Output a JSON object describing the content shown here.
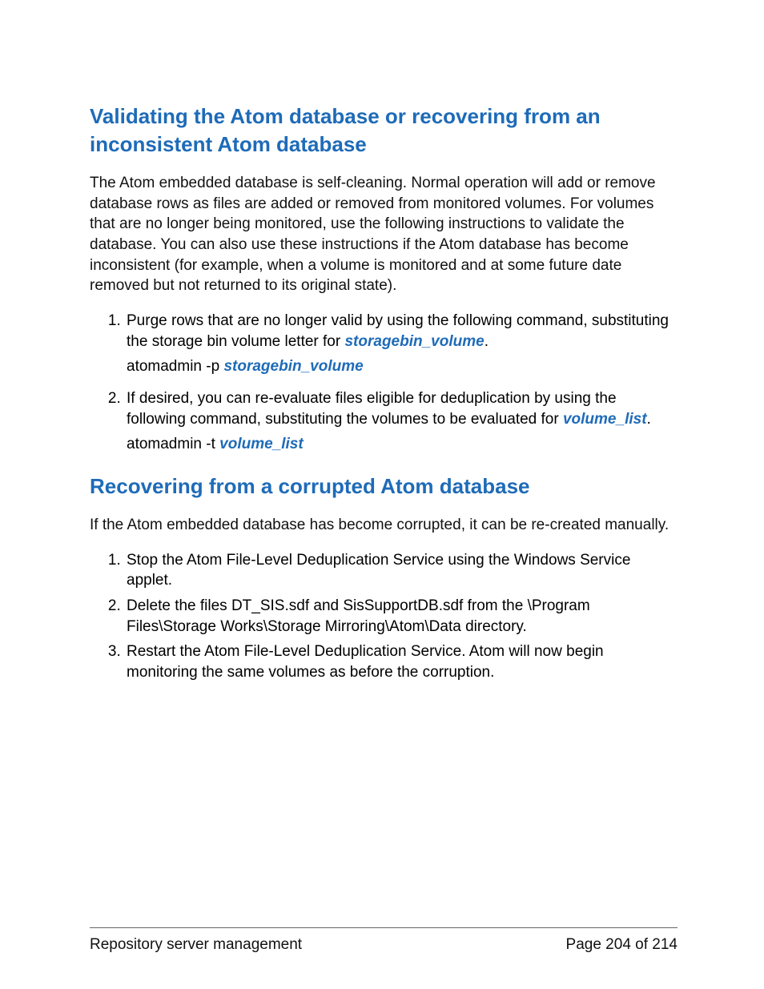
{
  "section1": {
    "title": "Validating the Atom database or recovering from an inconsistent Atom database",
    "intro": "The Atom embedded database is self-cleaning. Normal operation will add or remove database rows as files are added or removed from monitored volumes. For volumes that are no longer being monitored, use the following instructions to validate the database. You can also use these instructions if the Atom database has become inconsistent (for example, when a volume is monitored and at some future date removed but not returned to its original state).",
    "step1_pre": "Purge rows that are no longer valid by using the following command, substituting the storage bin volume letter for ",
    "step1_param": "storagebin_volume",
    "step1_post": ".",
    "cmd1_pre": "atomadmin -p ",
    "cmd1_param": "storagebin_volume",
    "step2_pre": "If desired, you can re-evaluate files eligible for deduplication by using the following command, substituting the volumes to be evaluated for ",
    "step2_param": "volume_list",
    "step2_post": ".",
    "cmd2_pre": "atomadmin -t ",
    "cmd2_param": "volume_list"
  },
  "section2": {
    "title": "Recovering from a corrupted Atom database",
    "intro": "If the Atom embedded database has become corrupted, it can be re-created manually.",
    "step1": "Stop the Atom File-Level Deduplication Service using the Windows Service applet.",
    "step2": "Delete the files DT_SIS.sdf and SisSupportDB.sdf from the \\Program Files\\Storage Works\\Storage Mirroring\\Atom\\Data directory.",
    "step3": "Restart the Atom File-Level Deduplication Service. Atom will now begin monitoring the same volumes as before the corruption."
  },
  "footer": {
    "left": "Repository server management",
    "right": "Page 204 of 214"
  }
}
